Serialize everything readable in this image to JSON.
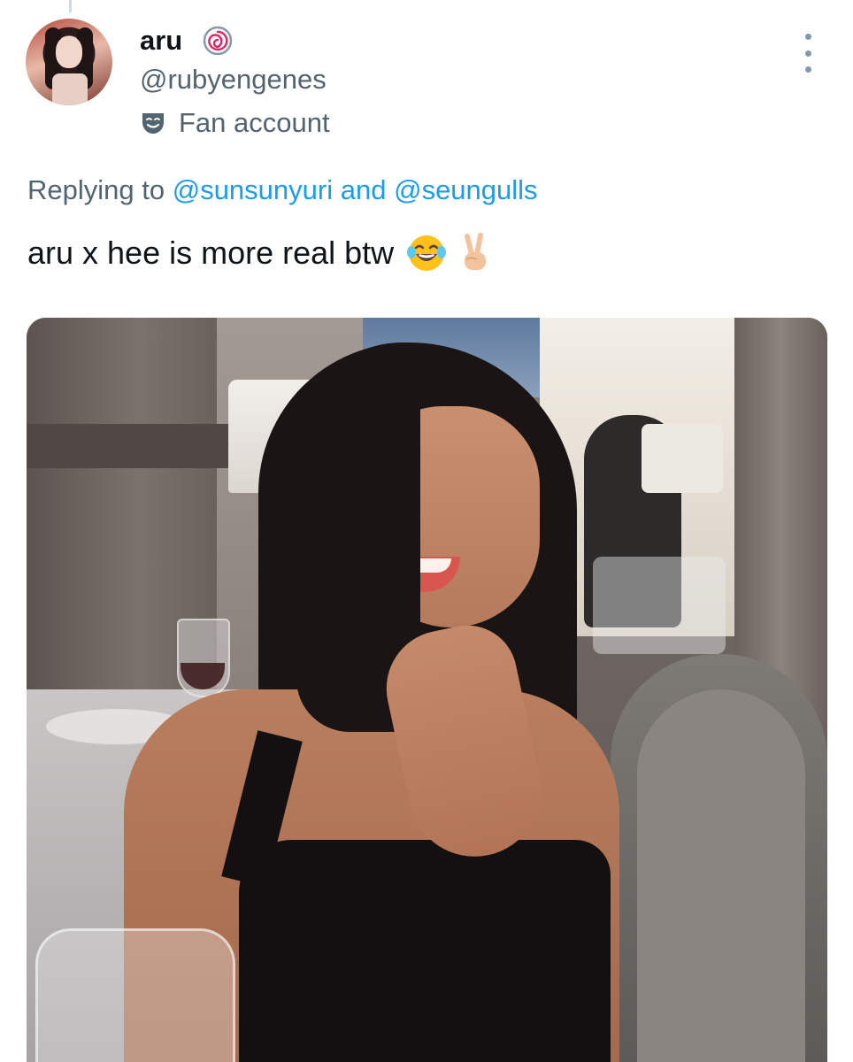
{
  "tweet": {
    "display_name": "aru",
    "badge_icon": "spiral-badge-icon",
    "handle": "@rubyengenes",
    "affiliation_icon": "theater-mask-icon",
    "affiliation": "Fan account",
    "more_icon": "more-vertical-icon",
    "reply_prefix": "Replying to",
    "reply_mention_1": "@sunsunyuri",
    "reply_and": "and",
    "reply_mention_2": "@seungulls",
    "text": "aru x hee is more real btw",
    "emojis": [
      "face-with-tears-of-joy-emoji",
      "victory-hand-emoji"
    ],
    "media": {
      "type": "photo"
    }
  },
  "colors": {
    "link": "#1d9bf0",
    "secondary_text": "#536471",
    "primary_text": "#0f1419",
    "background": "#ffffff"
  }
}
